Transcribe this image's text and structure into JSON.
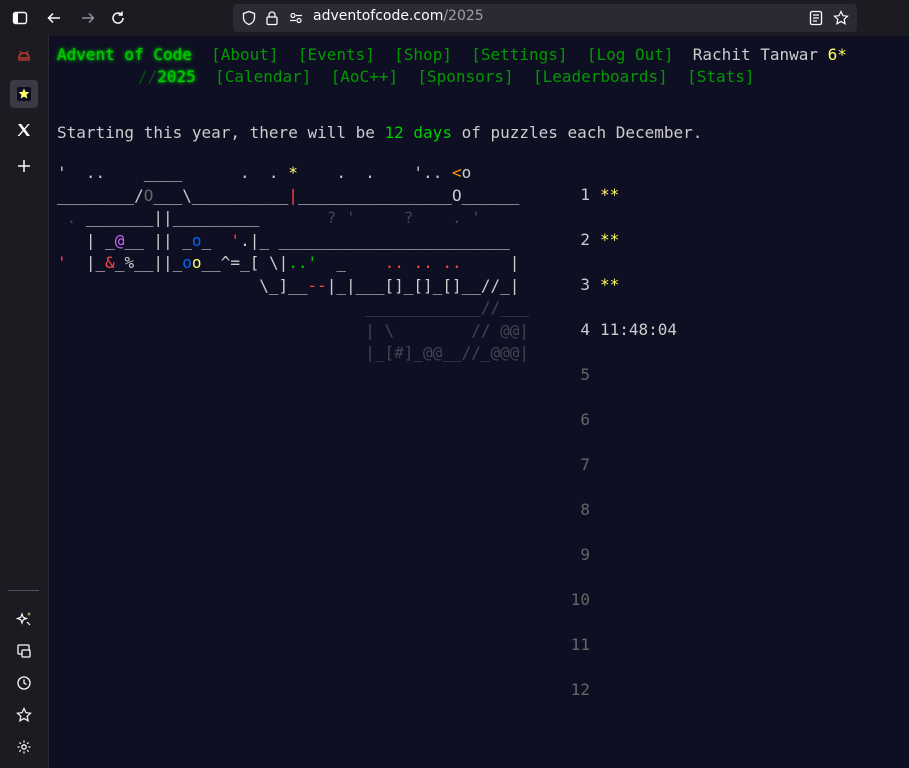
{
  "browser": {
    "url_host": "adventofcode.com",
    "url_path": "/2025"
  },
  "header": {
    "title": "Advent of Code",
    "nav1": [
      "[About]",
      "[Events]",
      "[Shop]",
      "[Settings]",
      "[Log Out]"
    ],
    "user": "Rachit Tanwar",
    "user_stars": "6*",
    "year_prefix": "//",
    "year": "2025",
    "nav2": [
      "[Calendar]",
      "[AoC++]",
      "[Sponsors]",
      "[Leaderboards]",
      "[Stats]"
    ]
  },
  "intro": {
    "before": "Starting this year, there will be ",
    "highlight": "12 days",
    "after": " of puzzles each December."
  },
  "calendar": {
    "days": [
      {
        "num": "1",
        "stars": "**",
        "time": ""
      },
      {
        "num": "2",
        "stars": "**",
        "time": ""
      },
      {
        "num": "3",
        "stars": "**",
        "time": ""
      },
      {
        "num": "4",
        "stars": "",
        "time": "11:48:04"
      },
      {
        "num": "5",
        "stars": "",
        "time": ""
      },
      {
        "num": "6",
        "stars": "",
        "time": ""
      },
      {
        "num": "7",
        "stars": "",
        "time": ""
      },
      {
        "num": "8",
        "stars": "",
        "time": ""
      },
      {
        "num": "9",
        "stars": "",
        "time": ""
      },
      {
        "num": "10",
        "stars": "",
        "time": ""
      },
      {
        "num": "11",
        "stars": "",
        "time": ""
      },
      {
        "num": "12",
        "stars": "",
        "time": ""
      }
    ]
  },
  "art_lines": [
    [
      {
        "t": "'  ..    ____      .  . ",
        "c": "c-grey"
      },
      {
        "t": "*",
        "c": "c-yellow"
      },
      {
        "t": "    .  .    '.. ",
        "c": "c-grey"
      },
      {
        "t": "<",
        "c": "c-orange"
      },
      {
        "t": "o",
        "c": "c-grey"
      }
    ],
    [
      {
        "t": "________/",
        "c": "c-grey"
      },
      {
        "t": "O",
        "c": "c-dim"
      },
      {
        "t": "___\\__________",
        "c": "c-grey"
      },
      {
        "t": "|",
        "c": "c-red"
      },
      {
        "t": "________________",
        "c": "c-grey"
      },
      {
        "t": "O",
        "c": "c-grey"
      },
      {
        "t": "______",
        "c": "c-grey"
      }
    ],
    [
      {
        "t": " . ",
        "c": "c-faint"
      },
      {
        "t": "_______||_________",
        "c": "c-grey"
      },
      {
        "t": "       ? '     ?    . '",
        "c": "c-faint"
      }
    ],
    [
      {
        "t": "   | _",
        "c": "c-grey"
      },
      {
        "t": "@",
        "c": "c-purple"
      },
      {
        "t": "__ || _",
        "c": "c-grey"
      },
      {
        "t": "o",
        "c": "c-blue"
      },
      {
        "t": "_  ",
        "c": "c-grey"
      },
      {
        "t": "'",
        "c": "c-red"
      },
      {
        "t": ".|_ ________________________",
        "c": "c-grey"
      }
    ],
    [
      {
        "t": "'",
        "c": "c-red"
      },
      {
        "t": "  |_",
        "c": "c-grey"
      },
      {
        "t": "&",
        "c": "c-red"
      },
      {
        "t": "_%__||_",
        "c": "c-grey"
      },
      {
        "t": "o",
        "c": "c-blue"
      },
      {
        "t": "o",
        "c": "c-yellow"
      },
      {
        "t": "__^=_[ \\|",
        "c": "c-grey"
      },
      {
        "t": "..'",
        "c": "c-green"
      },
      {
        "t": "  _    ",
        "c": "c-grey"
      },
      {
        "t": ".. .. ..",
        "c": "c-red"
      },
      {
        "t": "     |",
        "c": "c-grey"
      }
    ],
    [
      {
        "t": "                     \\_]__",
        "c": "c-grey"
      },
      {
        "t": "--",
        "c": "c-red"
      },
      {
        "t": "|_|___[]_[]_[]__//_|",
        "c": "c-grey"
      }
    ],
    [
      {
        "t": "                                ____________//___",
        "c": "c-faint"
      }
    ],
    [
      {
        "t": "                                | \\        // @@|",
        "c": "c-faint"
      }
    ],
    [
      {
        "t": "                                |_[#]_@@__//_@@@|",
        "c": "c-faint"
      }
    ]
  ]
}
